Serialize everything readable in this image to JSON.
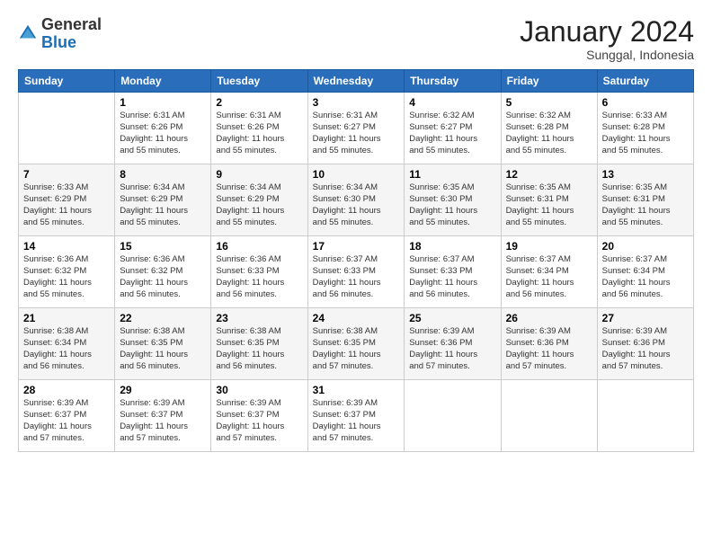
{
  "header": {
    "logo_general": "General",
    "logo_blue": "Blue",
    "month_title": "January 2024",
    "subtitle": "Sunggal, Indonesia"
  },
  "days_of_week": [
    "Sunday",
    "Monday",
    "Tuesday",
    "Wednesday",
    "Thursday",
    "Friday",
    "Saturday"
  ],
  "weeks": [
    [
      {
        "day": "",
        "info": ""
      },
      {
        "day": "1",
        "info": "Sunrise: 6:31 AM\nSunset: 6:26 PM\nDaylight: 11 hours\nand 55 minutes."
      },
      {
        "day": "2",
        "info": "Sunrise: 6:31 AM\nSunset: 6:26 PM\nDaylight: 11 hours\nand 55 minutes."
      },
      {
        "day": "3",
        "info": "Sunrise: 6:31 AM\nSunset: 6:27 PM\nDaylight: 11 hours\nand 55 minutes."
      },
      {
        "day": "4",
        "info": "Sunrise: 6:32 AM\nSunset: 6:27 PM\nDaylight: 11 hours\nand 55 minutes."
      },
      {
        "day": "5",
        "info": "Sunrise: 6:32 AM\nSunset: 6:28 PM\nDaylight: 11 hours\nand 55 minutes."
      },
      {
        "day": "6",
        "info": "Sunrise: 6:33 AM\nSunset: 6:28 PM\nDaylight: 11 hours\nand 55 minutes."
      }
    ],
    [
      {
        "day": "7",
        "info": "Sunrise: 6:33 AM\nSunset: 6:29 PM\nDaylight: 11 hours\nand 55 minutes."
      },
      {
        "day": "8",
        "info": "Sunrise: 6:34 AM\nSunset: 6:29 PM\nDaylight: 11 hours\nand 55 minutes."
      },
      {
        "day": "9",
        "info": "Sunrise: 6:34 AM\nSunset: 6:29 PM\nDaylight: 11 hours\nand 55 minutes."
      },
      {
        "day": "10",
        "info": "Sunrise: 6:34 AM\nSunset: 6:30 PM\nDaylight: 11 hours\nand 55 minutes."
      },
      {
        "day": "11",
        "info": "Sunrise: 6:35 AM\nSunset: 6:30 PM\nDaylight: 11 hours\nand 55 minutes."
      },
      {
        "day": "12",
        "info": "Sunrise: 6:35 AM\nSunset: 6:31 PM\nDaylight: 11 hours\nand 55 minutes."
      },
      {
        "day": "13",
        "info": "Sunrise: 6:35 AM\nSunset: 6:31 PM\nDaylight: 11 hours\nand 55 minutes."
      }
    ],
    [
      {
        "day": "14",
        "info": "Sunrise: 6:36 AM\nSunset: 6:32 PM\nDaylight: 11 hours\nand 55 minutes."
      },
      {
        "day": "15",
        "info": "Sunrise: 6:36 AM\nSunset: 6:32 PM\nDaylight: 11 hours\nand 56 minutes."
      },
      {
        "day": "16",
        "info": "Sunrise: 6:36 AM\nSunset: 6:33 PM\nDaylight: 11 hours\nand 56 minutes."
      },
      {
        "day": "17",
        "info": "Sunrise: 6:37 AM\nSunset: 6:33 PM\nDaylight: 11 hours\nand 56 minutes."
      },
      {
        "day": "18",
        "info": "Sunrise: 6:37 AM\nSunset: 6:33 PM\nDaylight: 11 hours\nand 56 minutes."
      },
      {
        "day": "19",
        "info": "Sunrise: 6:37 AM\nSunset: 6:34 PM\nDaylight: 11 hours\nand 56 minutes."
      },
      {
        "day": "20",
        "info": "Sunrise: 6:37 AM\nSunset: 6:34 PM\nDaylight: 11 hours\nand 56 minutes."
      }
    ],
    [
      {
        "day": "21",
        "info": "Sunrise: 6:38 AM\nSunset: 6:34 PM\nDaylight: 11 hours\nand 56 minutes."
      },
      {
        "day": "22",
        "info": "Sunrise: 6:38 AM\nSunset: 6:35 PM\nDaylight: 11 hours\nand 56 minutes."
      },
      {
        "day": "23",
        "info": "Sunrise: 6:38 AM\nSunset: 6:35 PM\nDaylight: 11 hours\nand 56 minutes."
      },
      {
        "day": "24",
        "info": "Sunrise: 6:38 AM\nSunset: 6:35 PM\nDaylight: 11 hours\nand 57 minutes."
      },
      {
        "day": "25",
        "info": "Sunrise: 6:39 AM\nSunset: 6:36 PM\nDaylight: 11 hours\nand 57 minutes."
      },
      {
        "day": "26",
        "info": "Sunrise: 6:39 AM\nSunset: 6:36 PM\nDaylight: 11 hours\nand 57 minutes."
      },
      {
        "day": "27",
        "info": "Sunrise: 6:39 AM\nSunset: 6:36 PM\nDaylight: 11 hours\nand 57 minutes."
      }
    ],
    [
      {
        "day": "28",
        "info": "Sunrise: 6:39 AM\nSunset: 6:37 PM\nDaylight: 11 hours\nand 57 minutes."
      },
      {
        "day": "29",
        "info": "Sunrise: 6:39 AM\nSunset: 6:37 PM\nDaylight: 11 hours\nand 57 minutes."
      },
      {
        "day": "30",
        "info": "Sunrise: 6:39 AM\nSunset: 6:37 PM\nDaylight: 11 hours\nand 57 minutes."
      },
      {
        "day": "31",
        "info": "Sunrise: 6:39 AM\nSunset: 6:37 PM\nDaylight: 11 hours\nand 57 minutes."
      },
      {
        "day": "",
        "info": ""
      },
      {
        "day": "",
        "info": ""
      },
      {
        "day": "",
        "info": ""
      }
    ]
  ]
}
